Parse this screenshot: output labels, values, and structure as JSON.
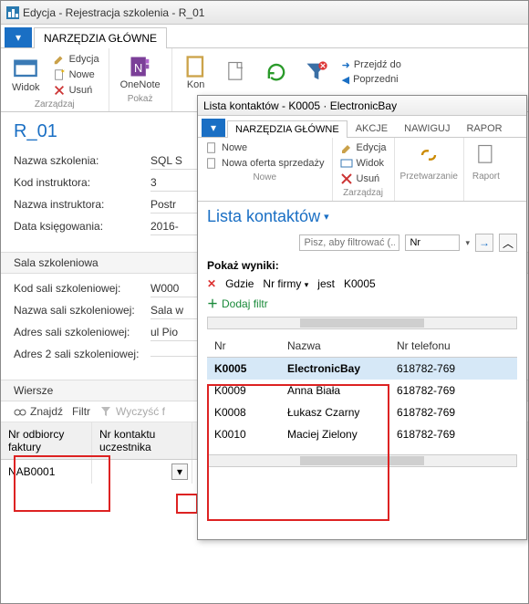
{
  "main": {
    "title": "Edycja - Rejestracja szkolenia - R_01",
    "tabs": {
      "home": "NARZĘDZIA GŁÓWNE"
    },
    "ribbon": {
      "widok": "Widok",
      "edycja": "Edycja",
      "nowe": "Nowe",
      "usun": "Usuń",
      "zarzadzaj": "Zarządzaj",
      "onenote": "OneNote",
      "pokaz": "Pokaż",
      "kon": "Kon",
      "przejdz": "Przejdź do",
      "poprzedni": "Poprzedni"
    },
    "form": {
      "heading": "R_01",
      "nazwa_szkolenia_l": "Nazwa szkolenia:",
      "nazwa_szkolenia_v": "SQL S",
      "kod_instruktora_l": "Kod instruktora:",
      "kod_instruktora_v": "3",
      "nazwa_instruktora_l": "Nazwa instruktora:",
      "nazwa_instruktora_v": "Postr",
      "data_ksiegowania_l": "Data księgowania:",
      "data_ksiegowania_v": "2016-"
    },
    "sala": {
      "head": "Sala szkoleniowa",
      "kod_l": "Kod sali szkoleniowej:",
      "kod_v": "W000",
      "nazwa_l": "Nazwa sali szkoleniowej:",
      "nazwa_v": "Sala w",
      "adres_l": "Adres sali szkoleniowej:",
      "adres_v": "ul Pio",
      "adres2_l": "Adres 2 sali szkoleniowej:",
      "adres2_v": ""
    },
    "wiersze": {
      "head": "Wiersze",
      "znajdz": "Znajdź",
      "filtr": "Filtr",
      "wyczysc": "Wyczyść f",
      "col1": "Nr odbiorcy faktury",
      "col2": "Nr kontaktu uczestnika",
      "val1": "NAB0001",
      "val2": ""
    }
  },
  "popup": {
    "title": "Lista kontaktów - K0005 · ElectronicBay",
    "tabs": {
      "home": "NARZĘDZIA GŁÓWNE",
      "akcje": "AKCJE",
      "nawiguj": "NAWIGUJ",
      "rapor": "RAPOR"
    },
    "ribbon": {
      "nowe": "Nowe",
      "nowa_oferta": "Nowa oferta sprzedaży",
      "nowe_grp": "Nowe",
      "edycja": "Edycja",
      "widok": "Widok",
      "usun": "Usuń",
      "zarzadzaj": "Zarządzaj",
      "przetw": "Przetwarzanie",
      "raport": "Raport"
    },
    "heading": "Lista kontaktów",
    "filter_placeholder": "Pisz, aby filtrować (...",
    "filter_field": "Nr",
    "results": "Pokaż wyniki:",
    "where": "Gdzie",
    "where_field": "Nr firmy",
    "where_op": "jest",
    "where_val": "K0005",
    "addfilter": "Dodaj filtr",
    "cols": {
      "nr": "Nr",
      "nazwa": "Nazwa",
      "tel": "Nr telefonu"
    },
    "rows": [
      {
        "nr": "K0005",
        "nazwa": "ElectronicBay",
        "tel": "618782-769"
      },
      {
        "nr": "K0009",
        "nazwa": "Anna Biała",
        "tel": "618782-769"
      },
      {
        "nr": "K0008",
        "nazwa": "Łukasz Czarny",
        "tel": "618782-769"
      },
      {
        "nr": "K0010",
        "nazwa": "Maciej Zielony",
        "tel": "618782-769"
      }
    ]
  }
}
